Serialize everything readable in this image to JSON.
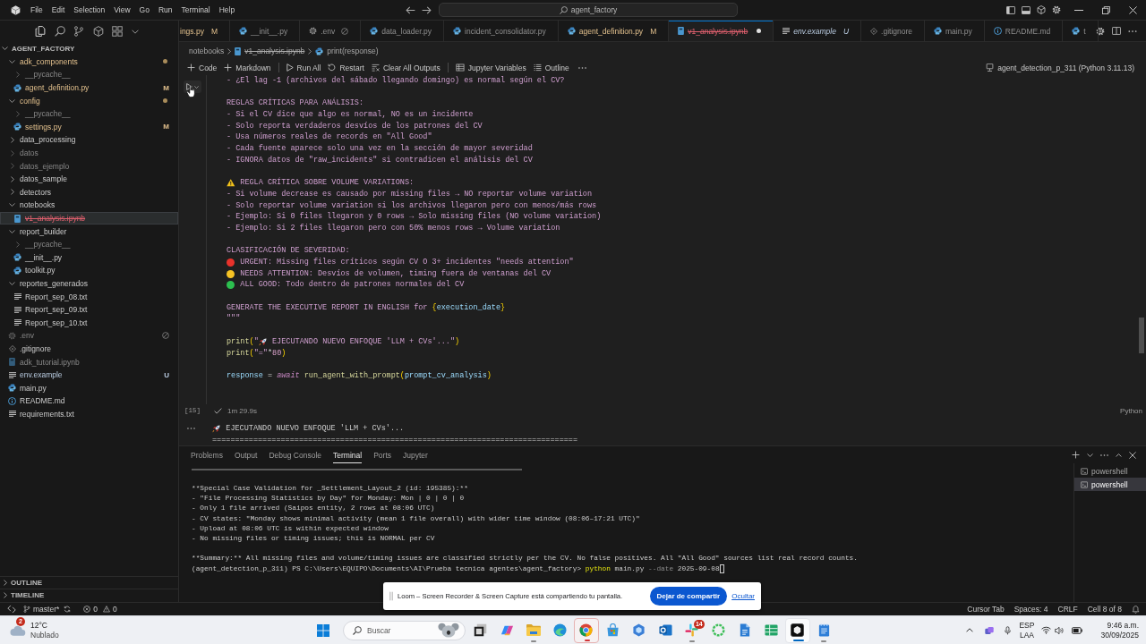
{
  "title_bar": {
    "menu": [
      "File",
      "Edit",
      "Selection",
      "View",
      "Go",
      "Run",
      "Terminal",
      "Help"
    ],
    "search": "agent_factory"
  },
  "explorer": {
    "title": "AGENT_FACTORY",
    "expanded": true,
    "items": [
      {
        "label": "adk_components",
        "kind": "folder",
        "modified": true,
        "ignored": false,
        "untracked": false,
        "deleted": false,
        "blocked": false,
        "expanded": true,
        "selected": false,
        "children": [
          {
            "label": "__pycache__",
            "kind": "folder",
            "modified": false,
            "ignored": true,
            "untracked": false,
            "deleted": false,
            "blocked": false,
            "expanded": false,
            "selected": false
          },
          {
            "label": "agent_definition.py",
            "kind": "python",
            "badge": "M",
            "modified": true,
            "ignored": false,
            "untracked": false,
            "deleted": false,
            "blocked": false,
            "selected": false
          }
        ]
      },
      {
        "label": "config",
        "kind": "folder",
        "modified": true,
        "ignored": false,
        "untracked": false,
        "deleted": false,
        "blocked": false,
        "expanded": true,
        "selected": false,
        "children": [
          {
            "label": "__pycache__",
            "kind": "folder",
            "modified": false,
            "ignored": true,
            "untracked": false,
            "deleted": false,
            "blocked": false,
            "expanded": false,
            "selected": false
          },
          {
            "label": "settings.py",
            "kind": "python",
            "badge": "M",
            "modified": true,
            "ignored": false,
            "untracked": false,
            "deleted": false,
            "blocked": false,
            "selected": false
          }
        ]
      },
      {
        "label": "data_processing",
        "kind": "folder",
        "modified": false,
        "ignored": false,
        "untracked": false,
        "deleted": false,
        "blocked": false,
        "expanded": false,
        "selected": false
      },
      {
        "label": "datos",
        "kind": "folder",
        "modified": false,
        "ignored": true,
        "untracked": false,
        "deleted": false,
        "blocked": false,
        "expanded": false,
        "selected": false
      },
      {
        "label": "datos_ejemplo",
        "kind": "folder",
        "modified": false,
        "ignored": true,
        "untracked": false,
        "deleted": false,
        "blocked": false,
        "expanded": false,
        "selected": false
      },
      {
        "label": "datos_sample",
        "kind": "folder",
        "modified": false,
        "ignored": false,
        "untracked": false,
        "deleted": false,
        "blocked": false,
        "expanded": false,
        "selected": false
      },
      {
        "label": "detectors",
        "kind": "folder",
        "modified": false,
        "ignored": false,
        "untracked": false,
        "deleted": false,
        "blocked": false,
        "expanded": false,
        "selected": false
      },
      {
        "label": "notebooks",
        "kind": "folder",
        "modified": false,
        "ignored": false,
        "untracked": false,
        "deleted": false,
        "blocked": false,
        "expanded": true,
        "selected": false,
        "children": [
          {
            "label": "v1_analysis.ipynb",
            "kind": "notebook",
            "modified": false,
            "ignored": false,
            "untracked": false,
            "deleted": true,
            "blocked": false,
            "selected": true
          }
        ]
      },
      {
        "label": "report_builder",
        "kind": "folder",
        "modified": false,
        "ignored": false,
        "untracked": false,
        "deleted": false,
        "blocked": false,
        "expanded": true,
        "selected": false,
        "children": [
          {
            "label": "__pycache__",
            "kind": "folder",
            "modified": false,
            "ignored": true,
            "untracked": false,
            "deleted": false,
            "blocked": false,
            "expanded": false,
            "selected": false
          },
          {
            "label": "__init__.py",
            "kind": "python",
            "modified": false,
            "ignored": false,
            "untracked": false,
            "deleted": false,
            "blocked": false,
            "selected": false
          },
          {
            "label": "toolkit.py",
            "kind": "python",
            "modified": false,
            "ignored": false,
            "untracked": false,
            "deleted": false,
            "blocked": false,
            "selected": false
          }
        ]
      },
      {
        "label": "reportes_generados",
        "kind": "folder",
        "modified": false,
        "ignored": false,
        "untracked": false,
        "deleted": false,
        "blocked": false,
        "expanded": true,
        "selected": false,
        "children": [
          {
            "label": "Report_sep_08.txt",
            "kind": "text",
            "modified": false,
            "ignored": false,
            "untracked": false,
            "deleted": false,
            "blocked": false,
            "selected": false
          },
          {
            "label": "Report_sep_09.txt",
            "kind": "text",
            "modified": false,
            "ignored": false,
            "untracked": false,
            "deleted": false,
            "blocked": false,
            "selected": false
          },
          {
            "label": "Report_sep_10.txt",
            "kind": "text",
            "modified": false,
            "ignored": false,
            "untracked": false,
            "deleted": false,
            "blocked": false,
            "selected": false
          }
        ]
      },
      {
        "label": ".env",
        "kind": "settings",
        "modified": false,
        "ignored": true,
        "untracked": false,
        "deleted": false,
        "blocked": true,
        "selected": false
      },
      {
        "label": ".gitignore",
        "kind": "git",
        "modified": false,
        "ignored": false,
        "untracked": false,
        "deleted": false,
        "blocked": false,
        "selected": false
      },
      {
        "label": "adk_tutorial.ipynb",
        "kind": "notebook",
        "modified": false,
        "ignored": true,
        "untracked": false,
        "deleted": false,
        "blocked": false,
        "selected": false
      },
      {
        "label": "env.example",
        "kind": "text",
        "badge": "U",
        "modified": false,
        "ignored": false,
        "untracked": true,
        "deleted": false,
        "blocked": false,
        "selected": false
      },
      {
        "label": "main.py",
        "kind": "python",
        "modified": false,
        "ignored": false,
        "untracked": false,
        "deleted": false,
        "blocked": false,
        "selected": false
      },
      {
        "label": "README.md",
        "kind": "info",
        "modified": false,
        "ignored": false,
        "untracked": false,
        "deleted": false,
        "blocked": false,
        "selected": false
      },
      {
        "label": "requirements.txt",
        "kind": "text",
        "modified": false,
        "ignored": false,
        "untracked": false,
        "deleted": false,
        "blocked": false,
        "selected": false
      }
    ],
    "sections": [
      {
        "label": "OUTLINE",
        "expanded": false
      },
      {
        "label": "TIMELINE",
        "expanded": false
      }
    ]
  },
  "tabs": [
    {
      "label": "ings.py",
      "kind": "partial",
      "badge": "M",
      "modified": true,
      "ignored": false,
      "untracked": false,
      "deleted": false,
      "preview": false,
      "dirty": false,
      "selected": false
    },
    {
      "label": "__init__.py",
      "kind": "python",
      "modified": false,
      "ignored": false,
      "untracked": false,
      "deleted": false,
      "preview": false,
      "dirty": false,
      "selected": false
    },
    {
      "label": ".env",
      "kind": "settings",
      "modified": false,
      "ignored": true,
      "untracked": false,
      "deleted": false,
      "preview": false,
      "dirty": false,
      "selected": false
    },
    {
      "label": "data_loader.py",
      "kind": "python",
      "modified": false,
      "ignored": false,
      "untracked": false,
      "deleted": false,
      "preview": false,
      "dirty": false,
      "selected": false
    },
    {
      "label": "incident_consolidator.py",
      "kind": "python",
      "modified": false,
      "ignored": false,
      "untracked": false,
      "deleted": false,
      "preview": false,
      "dirty": false,
      "selected": false
    },
    {
      "label": "agent_definition.py",
      "kind": "python",
      "badge": "M",
      "modified": true,
      "ignored": false,
      "untracked": false,
      "deleted": false,
      "preview": false,
      "dirty": false,
      "selected": false
    },
    {
      "label": "v1_analysis.ipynb",
      "kind": "notebook",
      "modified": false,
      "ignored": false,
      "untracked": false,
      "deleted": true,
      "preview": false,
      "dirty": true,
      "selected": true
    },
    {
      "label": "env.example",
      "kind": "text",
      "badge": "U",
      "modified": false,
      "ignored": false,
      "untracked": true,
      "deleted": false,
      "preview": true,
      "dirty": false,
      "selected": false
    },
    {
      "label": ".gitignore",
      "kind": "git",
      "modified": false,
      "ignored": false,
      "untracked": false,
      "deleted": false,
      "preview": false,
      "dirty": false,
      "selected": false
    },
    {
      "label": "main.py",
      "kind": "python",
      "modified": false,
      "ignored": false,
      "untracked": false,
      "deleted": false,
      "preview": false,
      "dirty": false,
      "selected": false
    },
    {
      "label": "README.md",
      "kind": "info",
      "modified": false,
      "ignored": false,
      "untracked": false,
      "deleted": false,
      "preview": false,
      "dirty": false,
      "selected": false
    },
    {
      "label": "t",
      "kind": "python",
      "modified": false,
      "ignored": false,
      "untracked": false,
      "deleted": false,
      "preview": false,
      "dirty": false,
      "selected": false
    }
  ],
  "notebook": {
    "breadcrumb": [
      {
        "label": "notebooks",
        "kind": "folder",
        "deleted": false
      },
      {
        "label": "v1_analysis.ipynb",
        "kind": "notebook",
        "deleted": true
      },
      {
        "label": "print(response)",
        "kind": "symbol",
        "deleted": false
      }
    ],
    "toolbar": {
      "groups": [
        [
          {
            "label": "Code",
            "kind": "add"
          },
          {
            "label": "Markdown",
            "kind": "add"
          }
        ],
        [
          {
            "label": "Run All",
            "kind": "run"
          },
          {
            "label": "Restart",
            "kind": "restart"
          },
          {
            "label": "Clear All Outputs",
            "kind": "clear"
          }
        ],
        [
          {
            "label": "Jupyter Variables",
            "kind": "variables"
          },
          {
            "label": "Outline",
            "kind": "outline"
          }
        ]
      ],
      "kernel": "agent_detection_p_311 (Python 3.11.13)"
    },
    "cell": {
      "lines": [
        {
          "kind": "text",
          "tokens": [
            {
              "text": "- ¿El lag -1 (archivos del sábado llegando domingo) es normal según el CV?",
              "kind": "string"
            }
          ]
        },
        {
          "kind": "blank"
        },
        {
          "kind": "text",
          "tokens": [
            {
              "text": "REGLAS CRÍTICAS PARA ANÁLISIS:",
              "kind": "string"
            }
          ]
        },
        {
          "kind": "text",
          "tokens": [
            {
              "text": "- Si el CV dice que algo es normal, NO es un incidente",
              "kind": "string"
            }
          ]
        },
        {
          "kind": "text",
          "tokens": [
            {
              "text": "- Solo reporta verdaderos desvíos de los patrones del CV",
              "kind": "string"
            }
          ]
        },
        {
          "kind": "text",
          "tokens": [
            {
              "text": "- Usa números reales de records en \"All Good\"",
              "kind": "string"
            }
          ]
        },
        {
          "kind": "text",
          "tokens": [
            {
              "text": "- Cada fuente aparece solo una vez en la sección de mayor severidad",
              "kind": "string"
            }
          ]
        },
        {
          "kind": "text",
          "tokens": [
            {
              "text": "- IGNORA datos de \"raw_incidents\" si contradicen el análisis del CV",
              "kind": "string"
            }
          ]
        },
        {
          "kind": "blank"
        },
        {
          "kind": "text",
          "tokens": [
            {
              "kind": "warning"
            },
            {
              "text": " REGLA CRÍTICA SOBRE VOLUME VARIATIONS:",
              "kind": "string"
            }
          ]
        },
        {
          "kind": "text",
          "tokens": [
            {
              "text": "- Si volume decrease es causado por missing files → NO reportar volume variation",
              "kind": "string"
            }
          ]
        },
        {
          "kind": "text",
          "tokens": [
            {
              "text": "- Solo reportar volume variation si los archivos llegaron pero con menos/más rows",
              "kind": "string"
            }
          ]
        },
        {
          "kind": "text",
          "tokens": [
            {
              "text": "- Ejemplo: Si 0 files llegaron y 0 rows → Solo missing files (NO volume variation)",
              "kind": "string"
            }
          ]
        },
        {
          "kind": "text",
          "tokens": [
            {
              "text": "- Ejemplo: Si 2 files llegaron pero con 50% menos rows → Volume variation",
              "kind": "string"
            }
          ]
        },
        {
          "kind": "blank"
        },
        {
          "kind": "text",
          "tokens": [
            {
              "text": "CLASIFICACIÓN DE SEVERIDAD:",
              "kind": "string"
            }
          ]
        },
        {
          "kind": "text",
          "tokens": [
            {
              "kind": "dot",
              "color": "#e8322b"
            },
            {
              "text": " URGENT: Missing files críticos según CV O 3+ incidentes \"needs attention\"",
              "kind": "string"
            }
          ]
        },
        {
          "kind": "text",
          "tokens": [
            {
              "kind": "dot",
              "color": "#f6c324"
            },
            {
              "text": " NEEDS ATTENTION: Desvíos de volumen, timing fuera de ventanas del CV",
              "kind": "string"
            }
          ]
        },
        {
          "kind": "text",
          "tokens": [
            {
              "kind": "dot",
              "color": "#2cbf4f"
            },
            {
              "text": " ALL GOOD: Todo dentro de patrones normales del CV",
              "kind": "string"
            }
          ]
        },
        {
          "kind": "blank"
        },
        {
          "kind": "text",
          "tokens": [
            {
              "text": "GENERATE THE EXECUTIVE REPORT IN ENGLISH for ",
              "kind": "string"
            },
            {
              "text": "{",
              "kind": "bracket"
            },
            {
              "text": "execution_date",
              "kind": "variable"
            },
            {
              "text": "}",
              "kind": "bracket"
            }
          ]
        },
        {
          "kind": "text",
          "tokens": [
            {
              "text": "\"\"\"",
              "kind": "string"
            }
          ]
        },
        {
          "kind": "blank"
        },
        {
          "kind": "text",
          "tokens": [
            {
              "text": "print",
              "kind": "function"
            },
            {
              "text": "(",
              "kind": "bracket"
            },
            {
              "text": "\"",
              "kind": "string"
            },
            {
              "kind": "rocket"
            },
            {
              "text": " EJECUTANDO NUEVO ENFOQUE 'LLM + CVs'...\"",
              "kind": "string"
            },
            {
              "text": ")",
              "kind": "bracket"
            }
          ]
        },
        {
          "kind": "text",
          "tokens": [
            {
              "text": "print",
              "kind": "function"
            },
            {
              "text": "(",
              "kind": "bracket"
            },
            {
              "text": "\"=\"",
              "kind": "string"
            },
            {
              "text": "*",
              "kind": "operator"
            },
            {
              "text": "80",
              "kind": "number"
            },
            {
              "text": ")",
              "kind": "bracket"
            }
          ]
        },
        {
          "kind": "blank"
        },
        {
          "kind": "text",
          "tokens": [
            {
              "text": "response",
              "kind": "variable"
            },
            {
              "text": " = ",
              "kind": "operator"
            },
            {
              "text": "await",
              "kind": "keyword"
            },
            {
              "text": " run_agent_with_prompt",
              "kind": "function"
            },
            {
              "text": "(",
              "kind": "bracket"
            },
            {
              "text": "prompt_cv_analysis",
              "kind": "variable"
            },
            {
              "text": ")",
              "kind": "bracket"
            }
          ]
        }
      ],
      "execution_count": "[15]",
      "succeeded": true,
      "duration": "1m 29.9s",
      "language": "Python"
    },
    "output": {
      "lines": [
        {
          "kind": "text",
          "tokens": [
            {
              "kind": "rocket"
            },
            {
              "text": " EJECUTANDO NUEVO ENFOQUE 'LLM + CVs'...",
              "kind": "plain"
            }
          ]
        },
        {
          "kind": "text",
          "tokens": [
            {
              "text": "================================================================================",
              "kind": "plain"
            }
          ]
        }
      ]
    }
  },
  "panel": {
    "tabs": [
      {
        "label": "Problems",
        "selected": false
      },
      {
        "label": "Output",
        "selected": false
      },
      {
        "label": "Debug Console",
        "selected": false
      },
      {
        "label": "Terminal",
        "selected": true
      },
      {
        "label": "Ports",
        "selected": false
      },
      {
        "label": "Jupyter",
        "selected": false
      }
    ],
    "terminal": [
      {
        "kind": "rule"
      },
      {
        "kind": "text",
        "text": "**Special Case Validation for _Settlement_Layout_2 (id: 195385):**"
      },
      {
        "kind": "text",
        "text": "- \"File Processing Statistics by Day\" for Monday: Mon | 0 | 0 | 0"
      },
      {
        "kind": "text",
        "text": "- Only 1 file arrived (Saipos entity, 2 rows at 08:06 UTC)"
      },
      {
        "kind": "text",
        "text": "- CV states: \"Monday shows minimal activity (mean 1 file overall) with wider time window (08:06–17:21 UTC)\""
      },
      {
        "kind": "text",
        "text": "- Upload at 08:06 UTC is within expected window"
      },
      {
        "kind": "text",
        "text": "- No missing files or timing issues; this is NORMAL per CV"
      },
      {
        "kind": "blank"
      },
      {
        "kind": "text",
        "text": "**Summary:** All missing files and volume/timing issues are classified strictly per the CV. No false positives. All \"All Good\" sources list real record counts."
      },
      {
        "kind": "prompt",
        "tokens": [
          {
            "text": "(agent_detection_p_311) PS C:\\Users\\EQUIPO\\Documents\\AI\\Prueba tecnica agentes\\agent_factory> ",
            "kind": "plain"
          },
          {
            "text": "python",
            "kind": "command"
          },
          {
            "text": " main.py ",
            "kind": "plain"
          },
          {
            "text": "--date",
            "kind": "parameter"
          },
          {
            "text": " 2025-09-08",
            "kind": "plain"
          },
          {
            "kind": "cursor"
          }
        ]
      }
    ],
    "sessions": [
      {
        "label": "powershell",
        "selected": false
      },
      {
        "label": "powershell",
        "selected": true
      }
    ]
  },
  "status_bar": {
    "branch": "master*",
    "errors": "0",
    "warnings": "0",
    "items": [
      "Cursor Tab",
      "Spaces: 4",
      "CRLF",
      "Cell 8 of 8"
    ]
  },
  "share_bar": {
    "message": "Loom – Screen Recorder & Screen Capture está compartiendo tu pantalla.",
    "button": "Dejar de compartir",
    "link": "Ocultar"
  },
  "taskbar": {
    "weather": {
      "badge": "2",
      "temperature": "12°C",
      "condition": "Nublado"
    },
    "search": "Buscar",
    "apps": [
      {
        "kind": "taskview",
        "running": false,
        "sharing": false,
        "selected": false
      },
      {
        "kind": "ribbon",
        "running": false,
        "sharing": false,
        "selected": false
      },
      {
        "kind": "folder",
        "running": true,
        "sharing": false,
        "selected": false
      },
      {
        "kind": "wave",
        "running": false,
        "sharing": false,
        "selected": false
      },
      {
        "kind": "segmented",
        "running": true,
        "sharing": true,
        "selected": false
      },
      {
        "kind": "bag",
        "running": false,
        "sharing": false,
        "selected": false
      },
      {
        "kind": "hexagon",
        "running": false,
        "sharing": false,
        "selected": false
      },
      {
        "kind": "ringtile",
        "running": false,
        "sharing": false,
        "selected": false
      },
      {
        "kind": "hash",
        "badge": "14",
        "running": true,
        "sharing": false,
        "selected": false
      },
      {
        "kind": "ring",
        "running": false,
        "sharing": false,
        "selected": false
      },
      {
        "kind": "doc",
        "running": false,
        "sharing": false,
        "selected": false
      },
      {
        "kind": "sheet",
        "running": false,
        "sharing": false,
        "selected": false
      },
      {
        "kind": "cubetile",
        "running": true,
        "sharing": false,
        "selected": true
      },
      {
        "kind": "notepad",
        "running": true,
        "sharing": false,
        "selected": false
      }
    ],
    "tray": {
      "language": "ESP",
      "layout": "LAA",
      "time": "9:46 a.m.",
      "date": "30/09/2025"
    }
  }
}
